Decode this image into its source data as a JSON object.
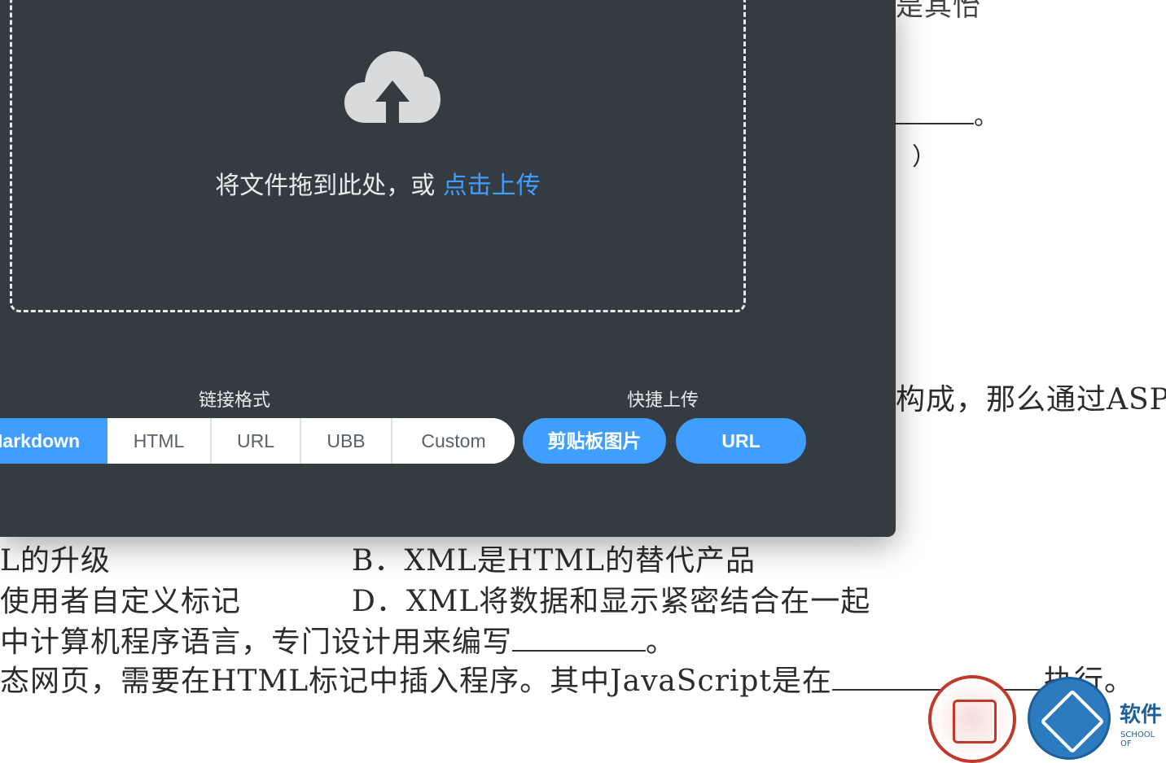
{
  "background_doc": {
    "row1": "是其怡",
    "row2_tail": "。",
    "row3": "）",
    "row4": "构成，那么通过ASP",
    "row5_left": "L的升级",
    "row5_right": "B．XML是HTML的替代产品",
    "row6_left": "使用者自定义标记",
    "row6_right": "D．XML将数据和显示紧密结合在一起",
    "row7": "中计算机程序语言，专门设计用来编写",
    "row7_tail": "。",
    "row8": "态网页，需要在HTML标记中插入程序。其中JavaScript是在",
    "row8_tail": "执行。",
    "school_logo_text": "软件",
    "school_logo_sub": "SCHOOL OF"
  },
  "upload": {
    "icon": "cloud-upload-icon",
    "drop_text": "将文件拖到此处，或",
    "click_text": "点击上传"
  },
  "link_format": {
    "label": "链接格式",
    "options": [
      "Markdown",
      "HTML",
      "URL",
      "UBB",
      "Custom"
    ],
    "selected": "Markdown"
  },
  "quick_upload": {
    "label": "快捷上传",
    "clipboard_label": "剪贴板图片",
    "url_label": "URL"
  },
  "colors": {
    "panel_bg": "#343c42",
    "accent": "#409eff",
    "dashed_border": "#e7e9eb"
  }
}
